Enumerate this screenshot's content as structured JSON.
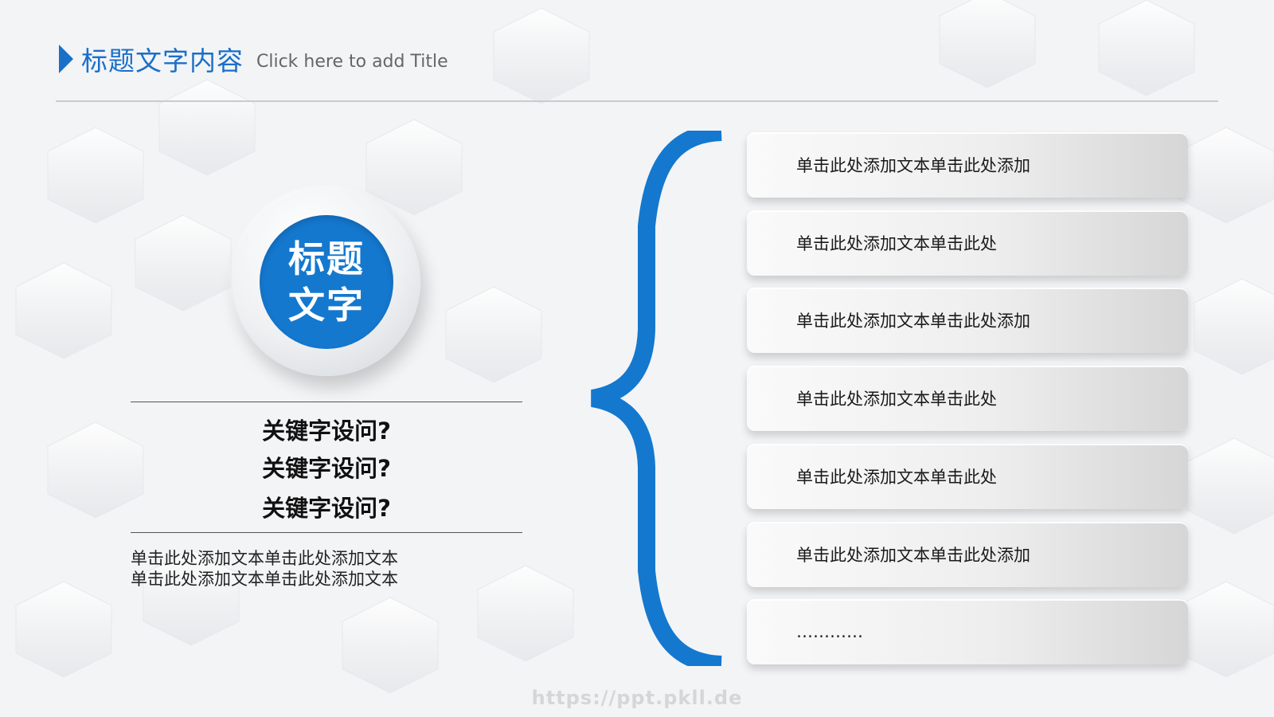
{
  "header": {
    "title_cn": "标题文字内容",
    "title_en": "Click here to add Title"
  },
  "emblem": {
    "line1": "标题",
    "line2": "文字"
  },
  "keywords": [
    "关键字设问?",
    "关键字设问?",
    "关键字设问?"
  ],
  "description": {
    "line1": "单击此处添加文本单击此处添加文本",
    "line2": "单击此处添加文本单击此处添加文本"
  },
  "list_items": [
    "单击此处添加文本单击此处添加",
    "单击此处添加文本单击此处",
    "单击此处添加文本单击此处添加",
    "单击此处添加文本单击此处",
    "单击此处添加文本单击此处",
    "单击此处添加文本单击此处添加",
    "…………"
  ],
  "watermark": "https://ppt.pkll.de",
  "colors": {
    "accent": "#1478cf",
    "title": "#1a6fc9",
    "rule": "#c9cbce"
  }
}
